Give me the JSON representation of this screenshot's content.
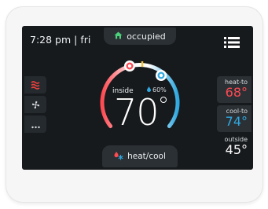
{
  "status_bar": {
    "time": "7:28 pm | fri",
    "occupancy": "occupied",
    "menu_icon": "hamburger-menu-icon"
  },
  "side_buttons": [
    {
      "icon": "heat-waves-icon",
      "color": "#e8413e"
    },
    {
      "icon": "fan-icon",
      "color": "#d5d9dc"
    },
    {
      "icon": "more-dots-icon",
      "color": "#d5d9dc"
    }
  ],
  "center": {
    "inside_label": "inside",
    "humidity": "60%",
    "inside_temp": "70"
  },
  "setpoints": {
    "heat_label": "heat-to",
    "heat_value": "68°",
    "heat_color": "#ff4a52",
    "cool_label": "cool-to",
    "cool_value": "74°",
    "cool_color": "#2fa8e0"
  },
  "outside": {
    "label": "outside",
    "value": "45°"
  },
  "mode": {
    "label": "heat/cool",
    "icon": "heat-cool-icon"
  },
  "colors": {
    "screen_bg": "#171a1d",
    "panel_bg": "#2b3034",
    "heat": "#ff4a52",
    "cool": "#2fa8e0",
    "occupied_icon": "#4cd07a"
  }
}
